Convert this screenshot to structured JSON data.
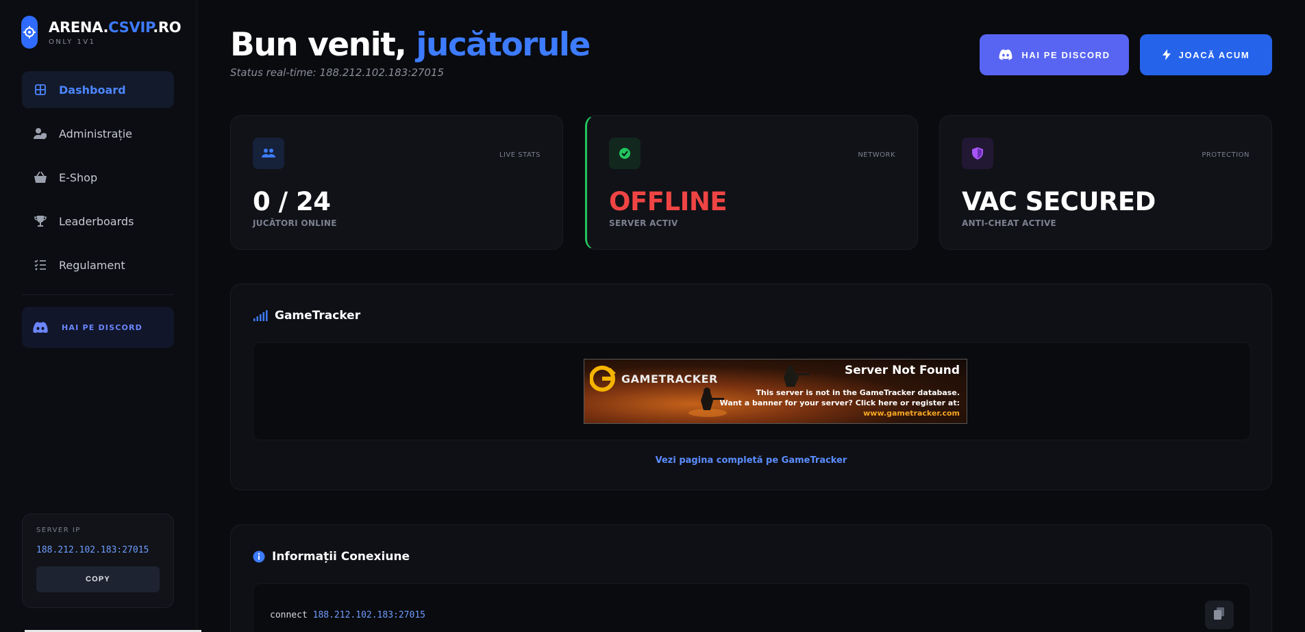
{
  "brand": {
    "title_main": "ARENA.",
    "title_accent": "CSVIP",
    "title_end": ".RO",
    "subtitle": "ONLY 1V1"
  },
  "nav": {
    "items": [
      {
        "label": "Dashboard",
        "icon": "grid-icon",
        "active": true
      },
      {
        "label": "Administrație",
        "icon": "user-shield-icon",
        "active": false
      },
      {
        "label": "E-Shop",
        "icon": "basket-icon",
        "active": false
      },
      {
        "label": "Leaderboards",
        "icon": "trophy-icon",
        "active": false
      },
      {
        "label": "Regulament",
        "icon": "list-check-icon",
        "active": false
      }
    ],
    "discord_label": "HAI PE DISCORD"
  },
  "ip_box": {
    "label": "SERVER IP",
    "value": "188.212.102.183:27015",
    "copy_label": "COPY"
  },
  "header": {
    "welcome_main": "Bun venit, ",
    "welcome_accent": "jucătorule",
    "status": "Status real-time: 188.212.102.183:27015",
    "discord_button": "HAI PE DISCORD",
    "play_button": "JOACĂ ACUM"
  },
  "stats": [
    {
      "tag": "LIVE STATS",
      "value": "0 / 24",
      "sub": "JUCĂTORI ONLINE",
      "icon": "users-icon",
      "color": "#3d7bff"
    },
    {
      "tag": "NETWORK",
      "value": "OFFLINE",
      "sub": "SERVER ACTIV",
      "icon": "check-circle-icon",
      "color": "#ef4444"
    },
    {
      "tag": "PROTECTION",
      "value": "VAC SECURED",
      "sub": "ANTI-CHEAT ACTIVE",
      "icon": "shield-icon",
      "color": "#a855f7"
    }
  ],
  "gametracker": {
    "title": "GameTracker",
    "banner": {
      "logo": "GAMETRACKER",
      "title": "Server Not Found",
      "line1": "This server is not in the GameTracker database.",
      "line2": "Want a banner for your server?  Click here or register at:",
      "line3": "www.gametracker.com"
    },
    "link": "Vezi pagina completă pe GameTracker"
  },
  "connection": {
    "title": "Informații Conexiune",
    "command": "connect",
    "ip": "188.212.102.183:27015"
  },
  "colors": {
    "accent": "#3d7bff",
    "discord": "#5865f2",
    "play": "#2563eb",
    "online": "#22c55e",
    "offline": "#ef4444",
    "background": "#0a0b0f"
  }
}
